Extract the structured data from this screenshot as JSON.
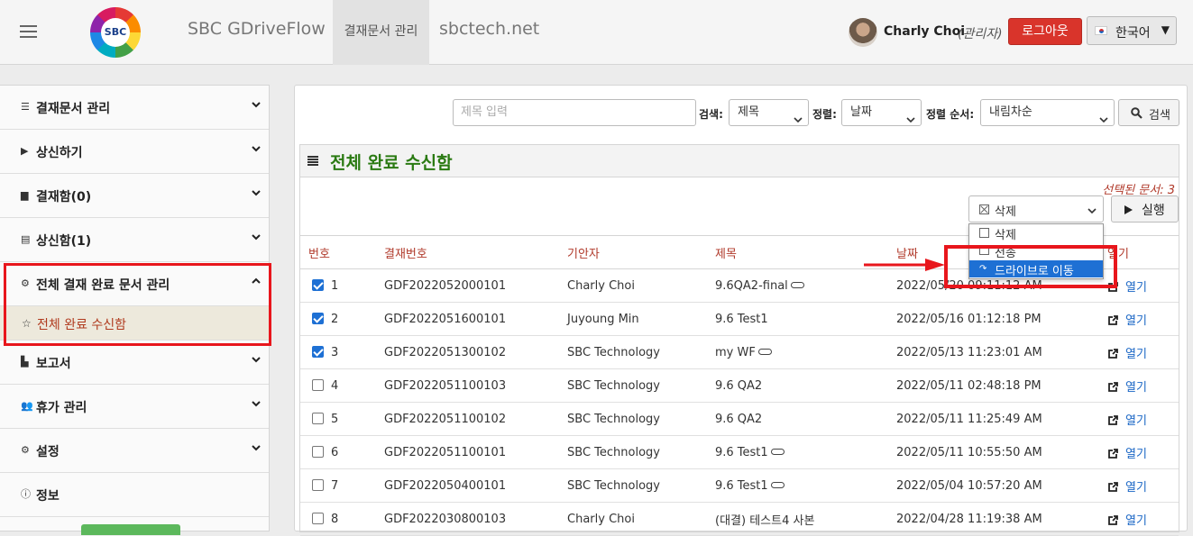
{
  "header": {
    "brand": "SBC GDriveFlow",
    "logo_text": "SBC",
    "nav_active": "결재문서 관리",
    "nav_site": "sbctech.net",
    "user_name": "Charly Choi",
    "user_role": "(관리자)",
    "logout_label": "로그아웃",
    "language": "한국어"
  },
  "sidebar": {
    "items": [
      {
        "label": "결재문서 관리",
        "icon": "list-icon"
      },
      {
        "label": "상신하기",
        "icon": "play-icon"
      },
      {
        "label": "결재함(0)",
        "icon": "briefcase-icon"
      },
      {
        "label": "상신함(1)",
        "icon": "clipboard-icon"
      },
      {
        "label": "전체 결재 완료 문서 관리",
        "icon": "gear-icon"
      },
      {
        "label": "보고서",
        "icon": "file-icon"
      },
      {
        "label": "휴가 관리",
        "icon": "users-icon"
      },
      {
        "label": "설정",
        "icon": "cog-icon"
      },
      {
        "label": "정보",
        "icon": "info-icon"
      }
    ],
    "sub_item": {
      "label": "전체 완료 수신함",
      "icon": "star-icon"
    }
  },
  "filters": {
    "search_placeholder": "제목 입력",
    "search_label": "검색:",
    "search_field": "제목",
    "sort_label": "정렬:",
    "sort_field": "날짜",
    "order_label": "정렬 순서:",
    "order_value": "내림차순",
    "search_button": "검색"
  },
  "panel": {
    "title": "전체 완료 수신함",
    "selected_count": "선택된 문서: 3",
    "action_value": "삭제",
    "run_label": "실행",
    "dropdown_options": [
      {
        "label": "삭제",
        "icon": "x-box-icon",
        "selected": false
      },
      {
        "label": "전송",
        "icon": "envelope-icon",
        "selected": false
      },
      {
        "label": "드라이브로 이동",
        "icon": "redo-icon",
        "selected": true
      }
    ]
  },
  "table": {
    "columns": [
      "번호",
      "결재번호",
      "기안자",
      "제목",
      "날짜",
      "열기"
    ],
    "rows": [
      {
        "checked": true,
        "no": "1",
        "doc_id": "GDF2022052000101",
        "author": "Charly Choi",
        "title": "9.6QA2-final",
        "attach": true,
        "date": "2022/05/20 09:11:12 AM",
        "open": "열기"
      },
      {
        "checked": true,
        "no": "2",
        "doc_id": "GDF2022051600101",
        "author": "Juyoung Min",
        "title": "9.6 Test1",
        "attach": false,
        "date": "2022/05/16 01:12:18 PM",
        "open": "열기"
      },
      {
        "checked": true,
        "no": "3",
        "doc_id": "GDF2022051300102",
        "author": "SBC Technology",
        "title": "my WF",
        "attach": true,
        "date": "2022/05/13 11:23:01 AM",
        "open": "열기"
      },
      {
        "checked": false,
        "no": "4",
        "doc_id": "GDF2022051100103",
        "author": "SBC Technology",
        "title": "9.6 QA2",
        "attach": false,
        "date": "2022/05/11 02:48:18 PM",
        "open": "열기"
      },
      {
        "checked": false,
        "no": "5",
        "doc_id": "GDF2022051100102",
        "author": "SBC Technology",
        "title": "9.6 QA2",
        "attach": false,
        "date": "2022/05/11 11:25:49 AM",
        "open": "열기"
      },
      {
        "checked": false,
        "no": "6",
        "doc_id": "GDF2022051100101",
        "author": "SBC Technology",
        "title": "9.6 Test1",
        "attach": true,
        "date": "2022/05/11 10:55:50 AM",
        "open": "열기"
      },
      {
        "checked": false,
        "no": "7",
        "doc_id": "GDF2022050400101",
        "author": "SBC Technology",
        "title": "9.6 Test1",
        "attach": true,
        "date": "2022/05/04 10:57:20 AM",
        "open": "열기"
      },
      {
        "checked": false,
        "no": "8",
        "doc_id": "GDF2022030800103",
        "author": "Charly Choi",
        "title": "(대결) 테스트4 사본",
        "attach": false,
        "date": "2022/04/28 11:19:38 AM",
        "open": "열기"
      }
    ]
  },
  "colors": {
    "accent_red": "#d9342b",
    "title_green": "#2a7a12",
    "header_red": "#b0392a",
    "link_blue": "#1a66c5",
    "highlight_box": "#e8161c"
  }
}
